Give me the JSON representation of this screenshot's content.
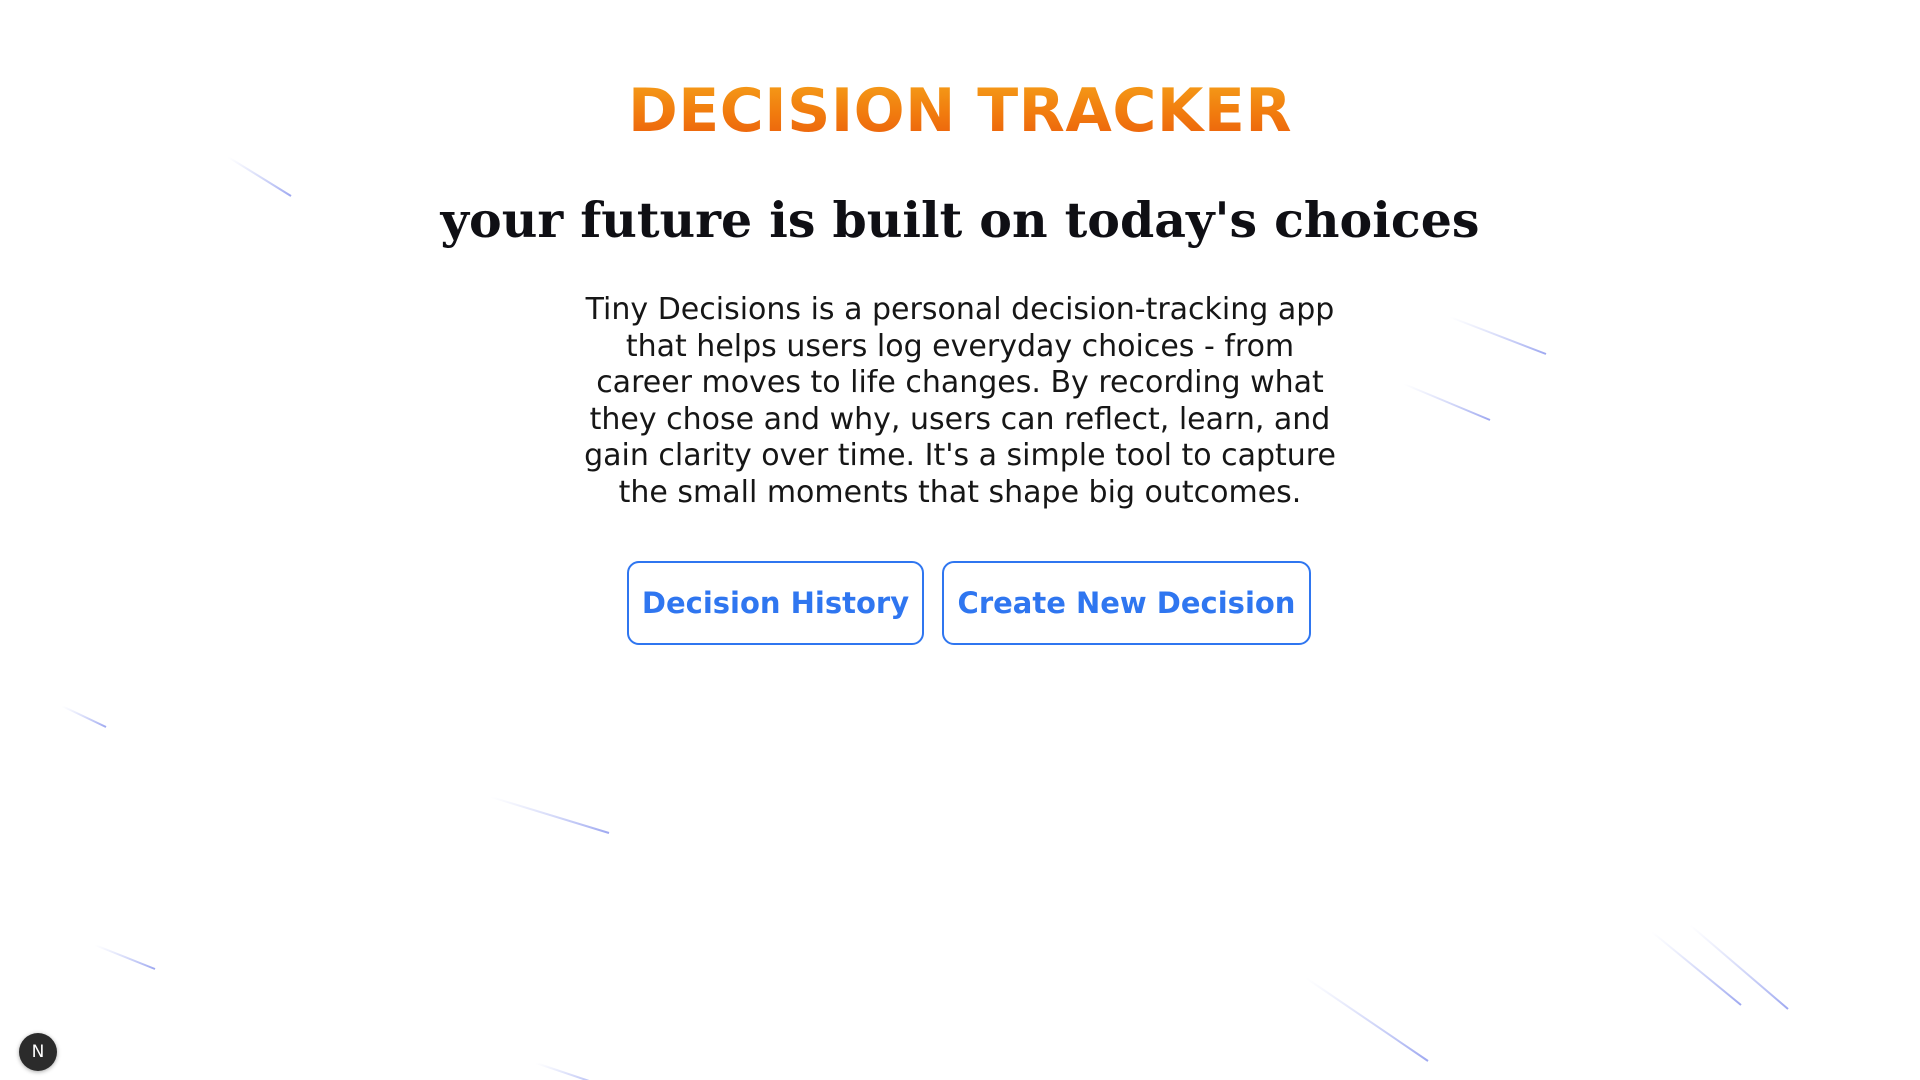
{
  "header": {
    "title": "DECISION TRACKER",
    "tagline": "your future is built on today's choices"
  },
  "intro": {
    "description": "Tiny Decisions is a personal decision-tracking app that helps users log everyday choices - from career moves to life changes. By recording what they chose and why, users can reflect, learn, and gain clarity over time. It's a simple tool to capture the small moments that shape big outcomes."
  },
  "actions": {
    "history_label": "Decision History",
    "create_label": "Create New Decision"
  },
  "dev_badge": {
    "label": "N",
    "icon": "nextjs-logo-icon"
  },
  "colors": {
    "title_gradient_top": "#f5a21a",
    "title_gradient_bottom": "#ea5b0c",
    "accent_blue": "#2f76f0",
    "text": "#161616",
    "streak": "#9aa6f0"
  }
}
